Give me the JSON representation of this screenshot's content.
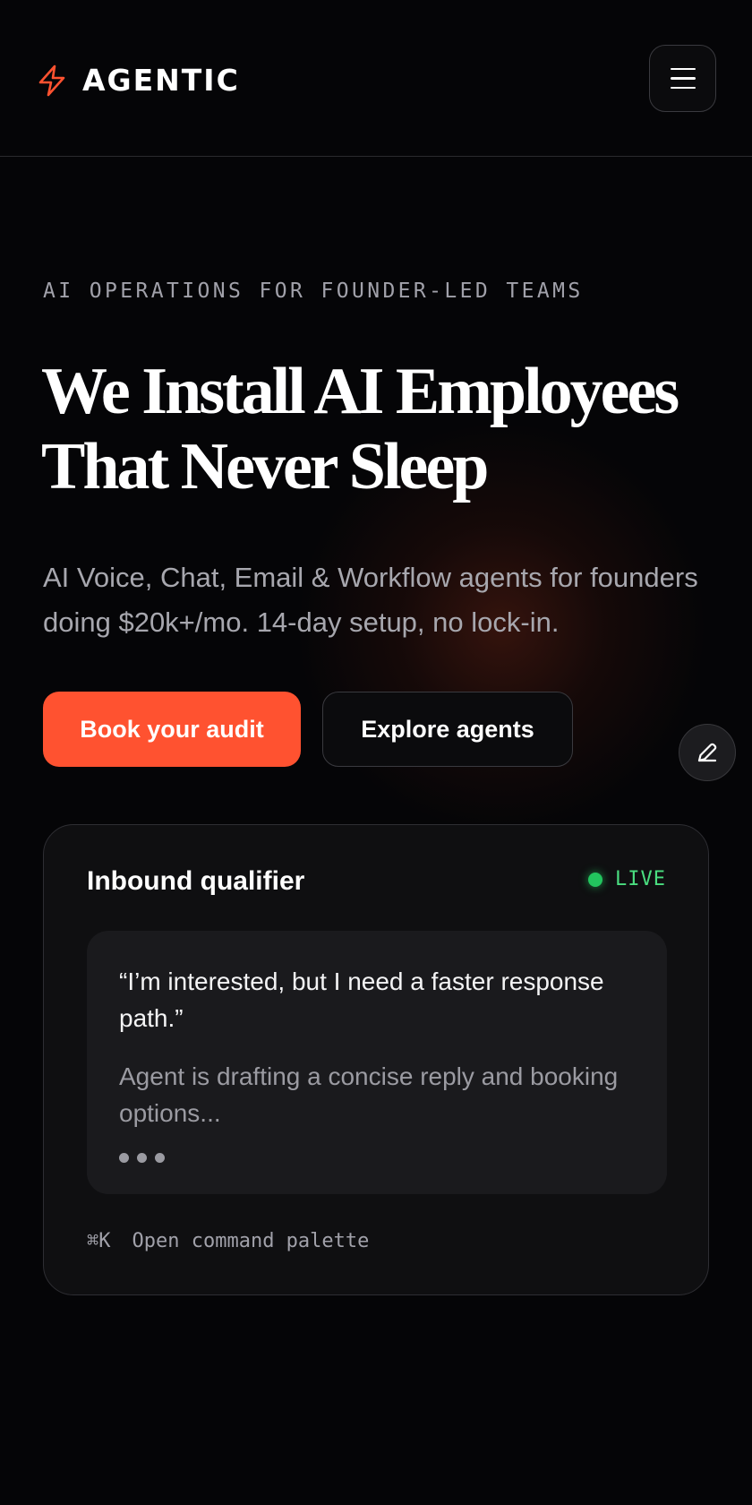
{
  "header": {
    "brand_name": "AGENTIC",
    "brand_icon": "lightning-bolt-icon",
    "menu_icon": "hamburger-menu-icon"
  },
  "hero": {
    "eyebrow": "AI OPERATIONS FOR FOUNDER-LED TEAMS",
    "headline_line1": "We Install AI Employees",
    "headline_line2": "That Never Sleep",
    "subhead": "AI Voice, Chat, Email & Workflow agents for founders doing $20k+/mo. 14-day setup, no lock-in.",
    "primary_cta": "Book your audit",
    "secondary_cta": "Explore agents",
    "edit_icon": "pencil-icon"
  },
  "card": {
    "title": "Inbound qualifier",
    "status": "LIVE",
    "quote": "“I’m interested, but I need a faster response path.”",
    "agent_status": "Agent is drafting a concise reply and booking options...",
    "shortcut_key": "⌘K",
    "shortcut_label": "Open command palette"
  },
  "colors": {
    "accent": "#ff5230",
    "background": "#050507",
    "live": "#22c55e"
  }
}
